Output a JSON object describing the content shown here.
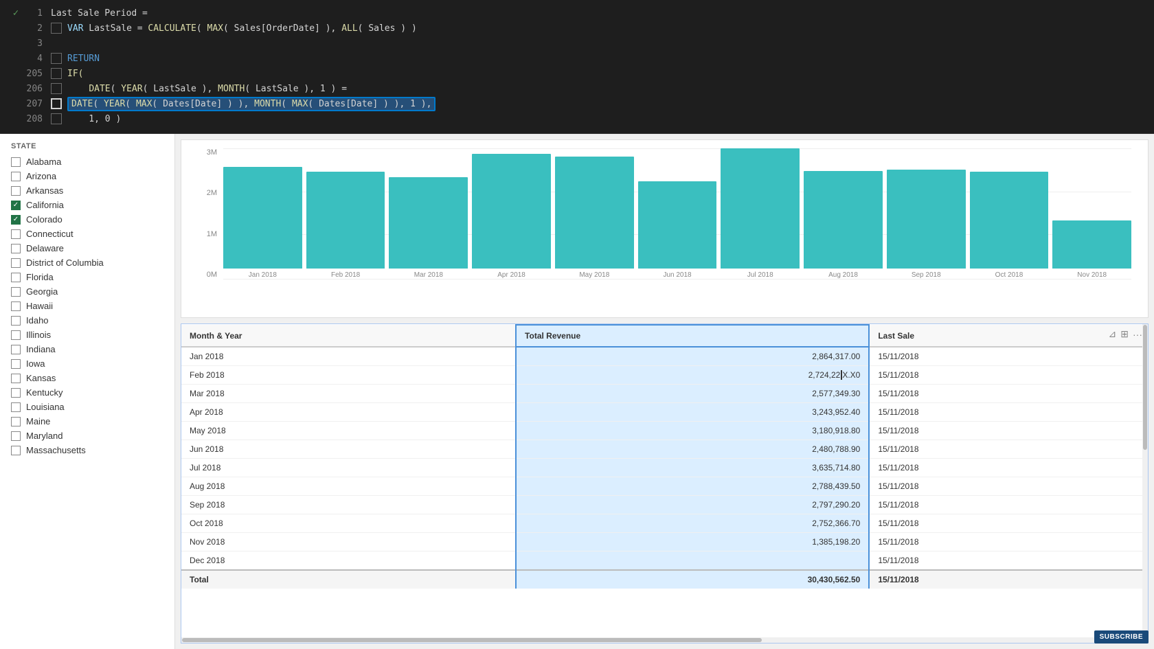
{
  "editor": {
    "lines": [
      {
        "lineNum": 1,
        "hasCheck": true,
        "checkSymbol": "✓",
        "hasCheckbox": false,
        "checkboxChecked": false,
        "text": "Last Sale Period =",
        "parts": [
          {
            "t": "plain",
            "v": "Last Sale Period ="
          }
        ]
      },
      {
        "lineNum": 2,
        "hasCheck": false,
        "hasCheckbox": true,
        "checkboxChecked": false,
        "text": "VAR LastSale = CALCULATE( MAX( Sales[OrderDate] ), ALL( Sales ) )",
        "parts": []
      },
      {
        "lineNum": 3,
        "hasCheck": false,
        "hasCheckbox": false,
        "text": "",
        "parts": []
      },
      {
        "lineNum": 4,
        "hasCheck": false,
        "hasCheckbox": true,
        "checkboxChecked": false,
        "text": "RETURN",
        "parts": [
          {
            "t": "keyword",
            "v": "RETURN"
          }
        ]
      },
      {
        "lineNum": 205,
        "hasCheck": false,
        "hasCheckbox": true,
        "checkboxChecked": false,
        "text": "IF(",
        "parts": [
          {
            "t": "keyword",
            "v": "IF("
          }
        ]
      },
      {
        "lineNum": 206,
        "hasCheck": false,
        "hasCheckbox": true,
        "checkboxChecked": false,
        "text": "    DATE( YEAR( LastSale ), MONTH( LastSale ), 1 ) =",
        "parts": []
      },
      {
        "lineNum": 207,
        "hasCheck": false,
        "hasCheckbox": true,
        "checkboxChecked": true,
        "highlighted": true,
        "text": "    DATE( YEAR( MAX( Dates[Date] ) ), MONTH( MAX( Dates[Date] ) ), 1 ),",
        "parts": []
      },
      {
        "lineNum": 208,
        "hasCheck": false,
        "hasCheckbox": true,
        "checkboxChecked": false,
        "text": "    1, 0 )",
        "parts": []
      }
    ]
  },
  "sidebar": {
    "title": "state",
    "states": [
      {
        "name": "Alabama",
        "checked": false
      },
      {
        "name": "Arizona",
        "checked": false
      },
      {
        "name": "Arkansas",
        "checked": false
      },
      {
        "name": "California",
        "checked": true
      },
      {
        "name": "Colorado",
        "checked": true
      },
      {
        "name": "Connecticut",
        "checked": false
      },
      {
        "name": "Delaware",
        "checked": false
      },
      {
        "name": "District of Columbia",
        "checked": false
      },
      {
        "name": "Florida",
        "checked": false
      },
      {
        "name": "Georgia",
        "checked": false
      },
      {
        "name": "Hawaii",
        "checked": false
      },
      {
        "name": "Idaho",
        "checked": false
      },
      {
        "name": "Illinois",
        "checked": false
      },
      {
        "name": "Indiana",
        "checked": false
      },
      {
        "name": "Iowa",
        "checked": false
      },
      {
        "name": "Kansas",
        "checked": false
      },
      {
        "name": "Kentucky",
        "checked": false
      },
      {
        "name": "Louisiana",
        "checked": false
      },
      {
        "name": "Maine",
        "checked": false
      },
      {
        "name": "Maryland",
        "checked": false
      },
      {
        "name": "Massachusetts",
        "checked": false
      }
    ]
  },
  "chart": {
    "yLabels": [
      "3M",
      "2M",
      "1M",
      "0M"
    ],
    "bars": [
      {
        "month": "Jan 2018",
        "value": 2864317,
        "heightPct": 78
      },
      {
        "month": "Feb 2018",
        "value": 2724220,
        "heightPct": 74
      },
      {
        "month": "Mar 2018",
        "value": 2577349,
        "heightPct": 70
      },
      {
        "month": "Apr 2018",
        "value": 3243952,
        "heightPct": 88
      },
      {
        "month": "May 2018",
        "value": 3180918,
        "heightPct": 86
      },
      {
        "month": "Jun 2018",
        "value": 2480788,
        "heightPct": 67
      },
      {
        "month": "Jul 2018",
        "value": 3635714,
        "heightPct": 98
      },
      {
        "month": "Aug 2018",
        "value": 2788439,
        "heightPct": 75
      },
      {
        "month": "Sep 2018",
        "value": 2797290,
        "heightPct": 76
      },
      {
        "month": "Oct 2018",
        "value": 2752366,
        "heightPct": 74
      },
      {
        "month": "Nov 2018",
        "value": 1385198,
        "heightPct": 37
      }
    ]
  },
  "table": {
    "columns": [
      "Month & Year",
      "Total Revenue",
      "Last Sale"
    ],
    "rows": [
      {
        "month": "Jan 2018",
        "revenue": "2,864,317.00",
        "lastSale": "15/11/2018"
      },
      {
        "month": "Feb 2018",
        "revenue": "2,724,22X.X0",
        "lastSale": "15/11/2018"
      },
      {
        "month": "Mar 2018",
        "revenue": "2,577,349.30",
        "lastSale": "15/11/2018"
      },
      {
        "month": "Apr 2018",
        "revenue": "3,243,952.40",
        "lastSale": "15/11/2018"
      },
      {
        "month": "May 2018",
        "revenue": "3,180,918.80",
        "lastSale": "15/11/2018"
      },
      {
        "month": "Jun 2018",
        "revenue": "2,480,788.90",
        "lastSale": "15/11/2018"
      },
      {
        "month": "Jul 2018",
        "revenue": "3,635,714.80",
        "lastSale": "15/11/2018"
      },
      {
        "month": "Aug 2018",
        "revenue": "2,788,439.50",
        "lastSale": "15/11/2018"
      },
      {
        "month": "Sep 2018",
        "revenue": "2,797,290.20",
        "lastSale": "15/11/2018"
      },
      {
        "month": "Oct 2018",
        "revenue": "2,752,366.70",
        "lastSale": "15/11/2018"
      },
      {
        "month": "Nov 2018",
        "revenue": "1,385,198.20",
        "lastSale": "15/11/2018"
      },
      {
        "month": "Dec 2018",
        "revenue": "",
        "lastSale": "15/11/2018"
      }
    ],
    "total": {
      "label": "Total",
      "revenue": "30,430,562.50",
      "lastSale": "15/11/2018"
    }
  },
  "branding": "SUBSCRIBE"
}
